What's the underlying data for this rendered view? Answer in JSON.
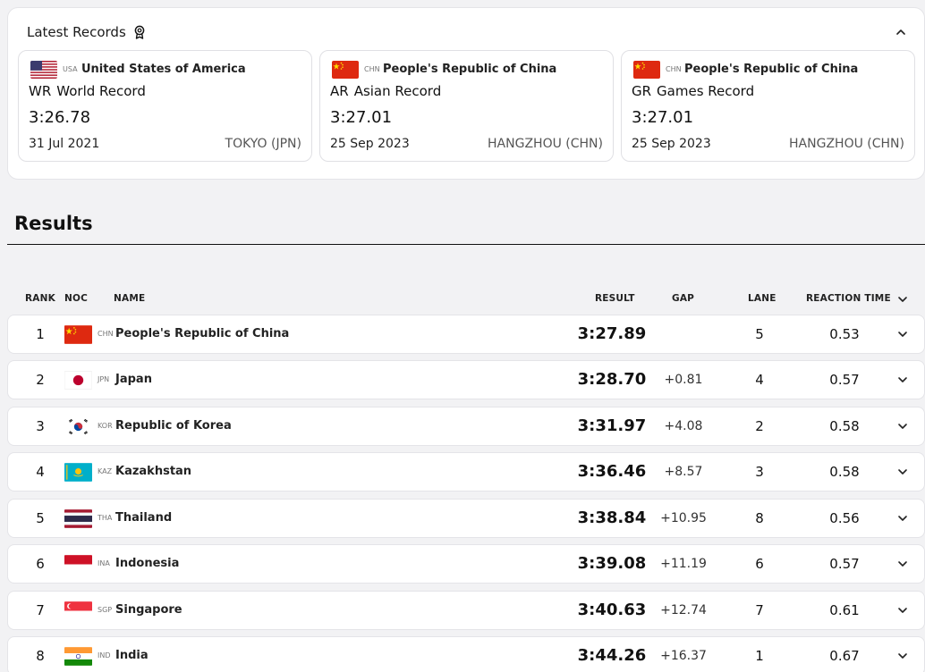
{
  "latest_records": {
    "title": "Latest Records",
    "items": [
      {
        "noc": "USA",
        "country": "United States of America",
        "abbr": "WR",
        "type": "World Record",
        "time": "3:26.78",
        "date": "31 Jul 2021",
        "place": "TOKYO (JPN)"
      },
      {
        "noc": "CHN",
        "country": "People's Republic of China",
        "abbr": "AR",
        "type": "Asian Record",
        "time": "3:27.01",
        "date": "25 Sep 2023",
        "place": "HANGZHOU (CHN)"
      },
      {
        "noc": "CHN",
        "country": "People's Republic of China",
        "abbr": "GR",
        "type": "Games Record",
        "time": "3:27.01",
        "date": "25 Sep 2023",
        "place": "HANGZHOU (CHN)"
      }
    ]
  },
  "results": {
    "title": "Results",
    "columns": {
      "rank": "RANK",
      "noc": "NOC",
      "name": "NAME",
      "result": "RESULT",
      "gap": "GAP",
      "lane": "LANE",
      "reaction": "REACTION TIME"
    },
    "rows": [
      {
        "rank": "1",
        "noc": "CHN",
        "name": "People's Republic of China",
        "result": "3:27.89",
        "gap": "",
        "lane": "5",
        "reaction": "0.53"
      },
      {
        "rank": "2",
        "noc": "JPN",
        "name": "Japan",
        "result": "3:28.70",
        "gap": "+0.81",
        "lane": "4",
        "reaction": "0.57"
      },
      {
        "rank": "3",
        "noc": "KOR",
        "name": "Republic of Korea",
        "result": "3:31.97",
        "gap": "+4.08",
        "lane": "2",
        "reaction": "0.58"
      },
      {
        "rank": "4",
        "noc": "KAZ",
        "name": "Kazakhstan",
        "result": "3:36.46",
        "gap": "+8.57",
        "lane": "3",
        "reaction": "0.58"
      },
      {
        "rank": "5",
        "noc": "THA",
        "name": "Thailand",
        "result": "3:38.84",
        "gap": "+10.95",
        "lane": "8",
        "reaction": "0.56"
      },
      {
        "rank": "6",
        "noc": "INA",
        "name": "Indonesia",
        "result": "3:39.08",
        "gap": "+11.19",
        "lane": "6",
        "reaction": "0.57"
      },
      {
        "rank": "7",
        "noc": "SGP",
        "name": "Singapore",
        "result": "3:40.63",
        "gap": "+12.74",
        "lane": "7",
        "reaction": "0.61"
      },
      {
        "rank": "8",
        "noc": "IND",
        "name": "India",
        "result": "3:44.26",
        "gap": "+16.37",
        "lane": "1",
        "reaction": "0.67"
      }
    ]
  },
  "icons": {
    "medal": "medal-icon",
    "collapse": "chevron-up-icon",
    "expand": "chevron-down-icon"
  },
  "colors": {
    "card_bg": "#ffffff",
    "page_bg": "#f2f2f4",
    "border": "#e4e4e8",
    "text": "#1a1a1a"
  }
}
